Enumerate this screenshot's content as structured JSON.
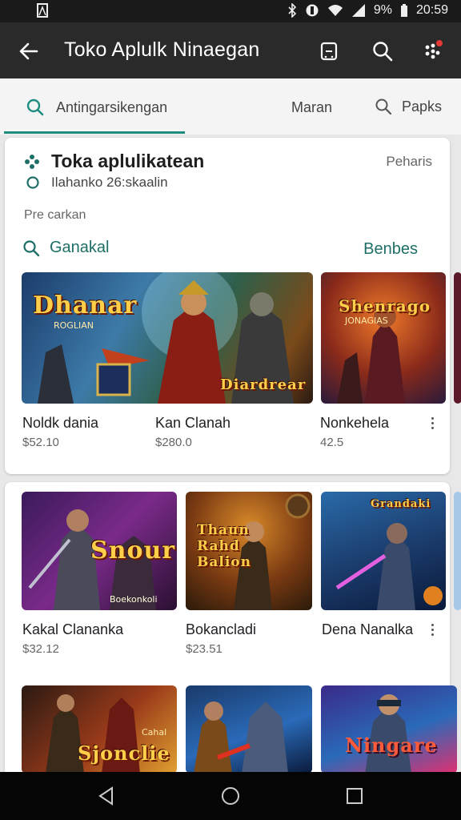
{
  "status_bar": {
    "battery": "9%",
    "time": "20:59",
    "icons": [
      "image-icon",
      "bluetooth-icon",
      "do-not-disturb-icon",
      "wifi-icon",
      "signal-icon",
      "battery-icon"
    ]
  },
  "app_bar": {
    "title": "Toko Aplulk Ninaegan",
    "icons": [
      "back-arrow-icon",
      "calendar-icon",
      "search-icon",
      "more-dots-icon"
    ],
    "notification_color": "#e53935"
  },
  "tabs": {
    "search_label": "Antingarsikengan",
    "other_label": "Maran",
    "pages_label": "Papks",
    "accent": "#1e8d80"
  },
  "store": {
    "title": "Toka aplulikatean",
    "side_label": "Peharis",
    "subtitle": "Ilahanko 26:skaalin",
    "small_label": "Pre carkan",
    "section_left": "Ganakal",
    "section_right": "Benbes"
  },
  "row1": [
    {
      "name": "Noldk dania",
      "price": "$52.10",
      "art": "Dhanar",
      "art_sub": "ROGLIAN"
    },
    {
      "name": "Kan Clanah",
      "price": "$280.0",
      "art": "Diardrear",
      "art_sub": ""
    },
    {
      "name": "Nonkehela",
      "price": "42.5",
      "art": "Shenrago",
      "art_sub": "JONAGIAS"
    }
  ],
  "row2": [
    {
      "name": "Kakal Clananka",
      "price": "$32.12",
      "art": "Snour",
      "art_sub": "Boekonkoli"
    },
    {
      "name": "Bokancladi",
      "price": "$23.51",
      "art": "Thaun Rahd Balion",
      "art_sub": ""
    },
    {
      "name": "Dena Nanalka",
      "price": "",
      "art": "Grandaki",
      "art_sub": ""
    }
  ],
  "row3": [
    {
      "art": "Sjonclie",
      "art_sub": "Cahal"
    },
    {
      "art": "",
      "art_sub": ""
    },
    {
      "art": "Ningare",
      "art_sub": ""
    }
  ],
  "nav_bar": {
    "icons": [
      "back-triangle-icon",
      "home-circle-icon",
      "recents-square-icon"
    ]
  }
}
